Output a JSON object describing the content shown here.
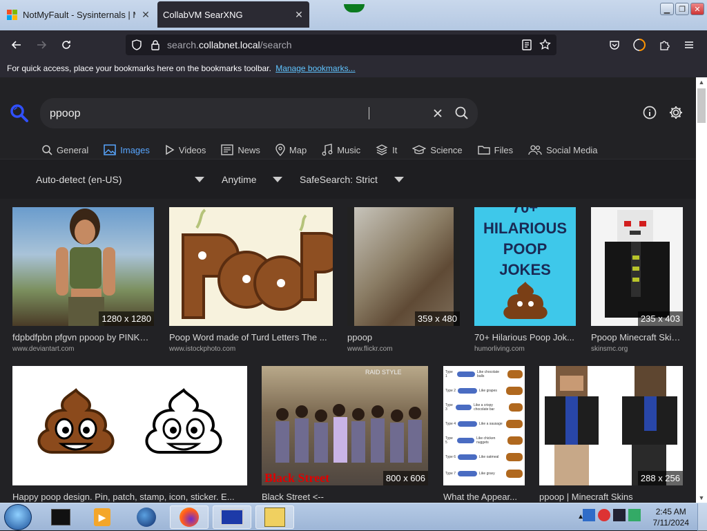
{
  "browser": {
    "tabs": [
      {
        "title": "NotMyFault - Sysinternals | Mic",
        "active": false
      },
      {
        "title": "CollabVM SearXNG",
        "active": true
      }
    ],
    "url_prefix": "search.",
    "url_domain": "collabnet.local",
    "url_path": "/search",
    "bookmarks_text": "For quick access, place your bookmarks here on the bookmarks toolbar.",
    "bookmarks_link": "Manage bookmarks..."
  },
  "search": {
    "query": "ppoop",
    "categories": [
      "General",
      "Images",
      "Videos",
      "News",
      "Map",
      "Music",
      "It",
      "Science",
      "Files",
      "Social Media"
    ],
    "active_category": "Images",
    "filters": {
      "language": "Auto-detect (en-US)",
      "time": "Anytime",
      "safesearch": "SafeSearch: Strict"
    }
  },
  "results": [
    {
      "title": "fdpbdfpbn pfgvn ppoop by PINKYF...",
      "url": "www.deviantart.com",
      "dims": "1280 x 1280"
    },
    {
      "title": "Poop Word made of Turd Letters The ...",
      "url": "www.istockphoto.com",
      "dims": ""
    },
    {
      "title": "ppoop",
      "url": "www.flickr.com",
      "dims": "359 x 480"
    },
    {
      "title": "70+ Hilarious Poop Jok...",
      "url": "humorliving.com",
      "dims": "",
      "img_text": "70+ HILARIOUS POOP JOKES"
    },
    {
      "title": "Ppoop Minecraft Skin...",
      "url": "skinsmc.org",
      "dims": "235 x 403"
    },
    {
      "title": "Happy poop design. Pin, patch, stamp, icon, sticker. E...",
      "url": "",
      "dims": ""
    },
    {
      "title": "Black Street <--",
      "url": "",
      "dims": "800 x 606",
      "img_text": "Black Street",
      "img_text2": "RAID STYLE"
    },
    {
      "title": "What the Appear...",
      "url": "",
      "dims": "",
      "chart_labels": [
        "Type 1",
        "Type 2",
        "Type 3",
        "Type 4",
        "Type 5",
        "Type 6",
        "Type 7"
      ],
      "chart_captions": [
        "Like chocolate balls",
        "Like grapes",
        "Like a crispy chocolate bar",
        "Like a sausage",
        "Like chicken nuggets",
        "Like oatmeal",
        "Like gravy"
      ]
    },
    {
      "title": "ppoop | Minecraft Skins",
      "url": "",
      "dims": "288 x 256"
    }
  ],
  "taskbar": {
    "time": "2:45 AM",
    "date": "7/11/2024"
  },
  "colors": {
    "accent": "#58a6ff",
    "page_bg": "#222225",
    "toolbar_bg": "#2b2a33"
  }
}
